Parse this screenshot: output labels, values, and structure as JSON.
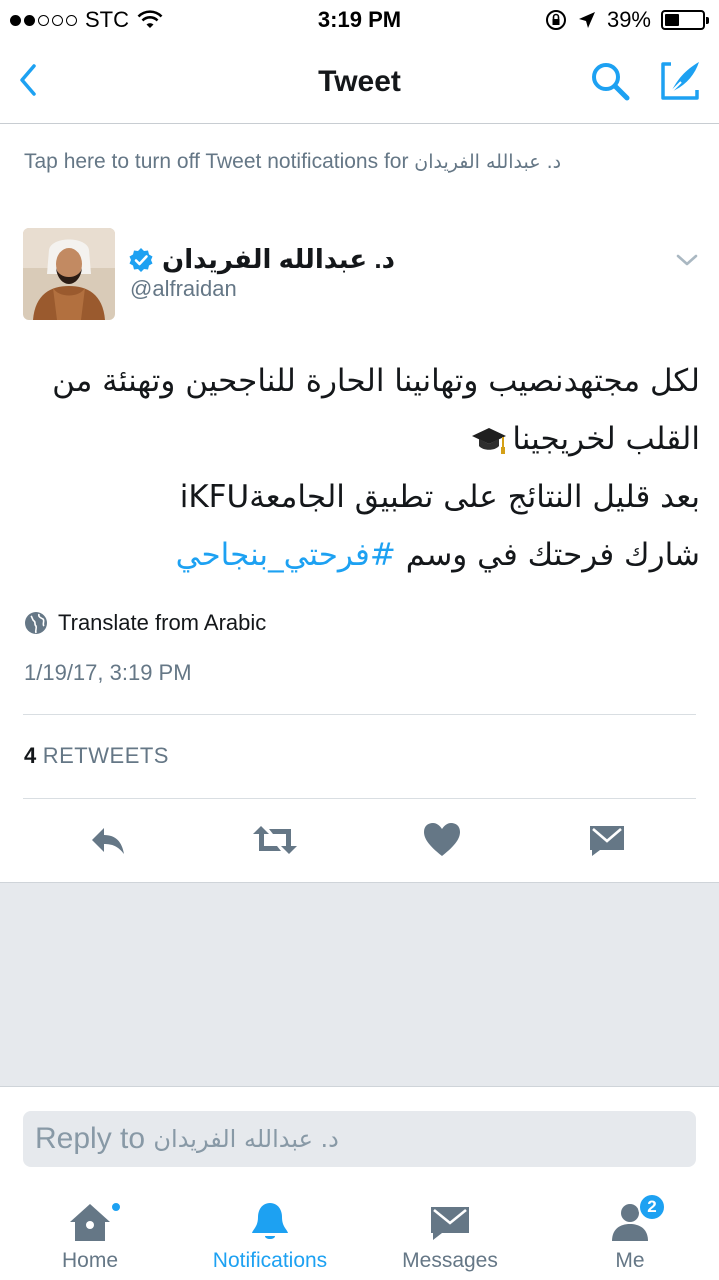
{
  "status_bar": {
    "carrier": "STC",
    "time": "3:19 PM",
    "battery_percent": "39%",
    "battery_level": 0.39,
    "signal_bars_filled": 2,
    "signal_bars_total": 5
  },
  "nav": {
    "title": "Tweet",
    "icons": [
      "back-chevron-icon",
      "search-icon",
      "compose-tweet-icon"
    ]
  },
  "notification_banner": {
    "text": "Tap here to turn off Tweet notifications for",
    "name": "د. عبدالله الفريدان"
  },
  "tweet": {
    "display_name": "د. عبدالله الفريدان",
    "handle": "@alfraidan",
    "verified": true,
    "lines": [
      "لكل مجتهدنصيب وتهانينا الحارة للناجحين وتهنئة من",
      "القلب لخريجينا",
      "بعد قليل النتائج على تطبيق الجامعةiKFU",
      "شارك فرحتك في وسم"
    ],
    "hashtag": "#فرحتي_بنجاحي",
    "translate_label": "Translate from Arabic",
    "timestamp": "1/19/17, 3:19 PM",
    "retweet_count": "4",
    "retweet_label": "RETWEETS"
  },
  "actions": [
    "reply-icon",
    "retweet-icon",
    "like-heart-icon",
    "direct-message-icon"
  ],
  "reply": {
    "prefix": "Reply to",
    "name": "د. عبدالله الفريدان"
  },
  "tabs": [
    {
      "label": "Home",
      "icon": "home-icon",
      "active": false,
      "dot": true
    },
    {
      "label": "Notifications",
      "icon": "bell-icon",
      "active": true
    },
    {
      "label": "Messages",
      "icon": "envelope-icon",
      "active": false
    },
    {
      "label": "Me",
      "icon": "profile-icon",
      "active": false,
      "badge": "2"
    }
  ],
  "colors": {
    "accent": "#1da1f2",
    "secondary_text": "#657786",
    "primary_text": "#14171a",
    "grey_background": "#e6e9ed"
  }
}
